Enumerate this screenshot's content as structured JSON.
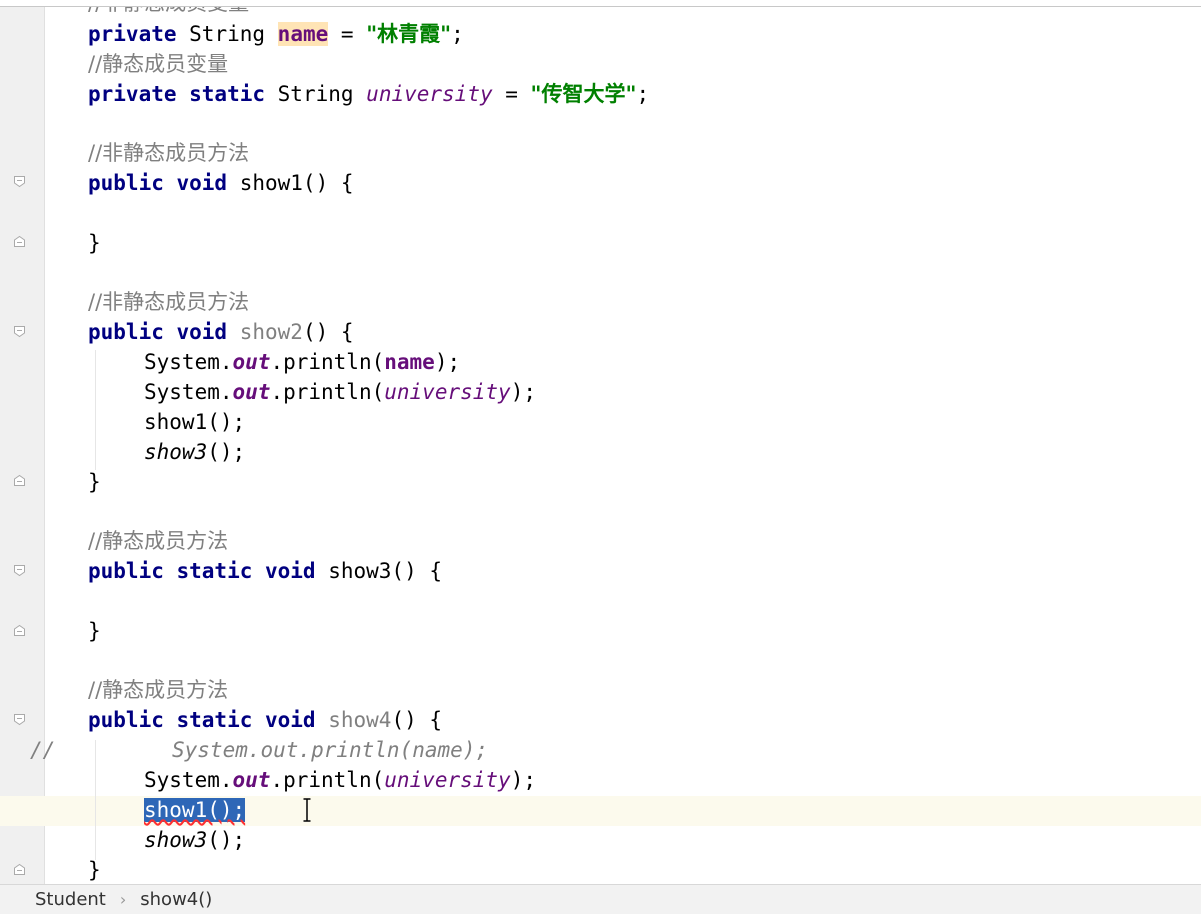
{
  "editor": {
    "comment_marker": "//",
    "strings": {
      "name_value": "\"林青霞\"",
      "university_value": "\"传智大学\""
    },
    "comments": {
      "nonstatic_var_partial": "//非静态成员变量",
      "static_var": "//静态成员变量",
      "nonstatic_method_1": "//非静态成员方法",
      "nonstatic_method_2": "//非静态成员方法",
      "static_method_1": "//静态成员方法",
      "static_method_2": "//静态成员方法"
    },
    "commented_code": "System.out.println(name);",
    "selected_text": "show1();"
  },
  "breadcrumb": {
    "class_name": "Student",
    "separator": "›",
    "method_name": "show4()"
  }
}
